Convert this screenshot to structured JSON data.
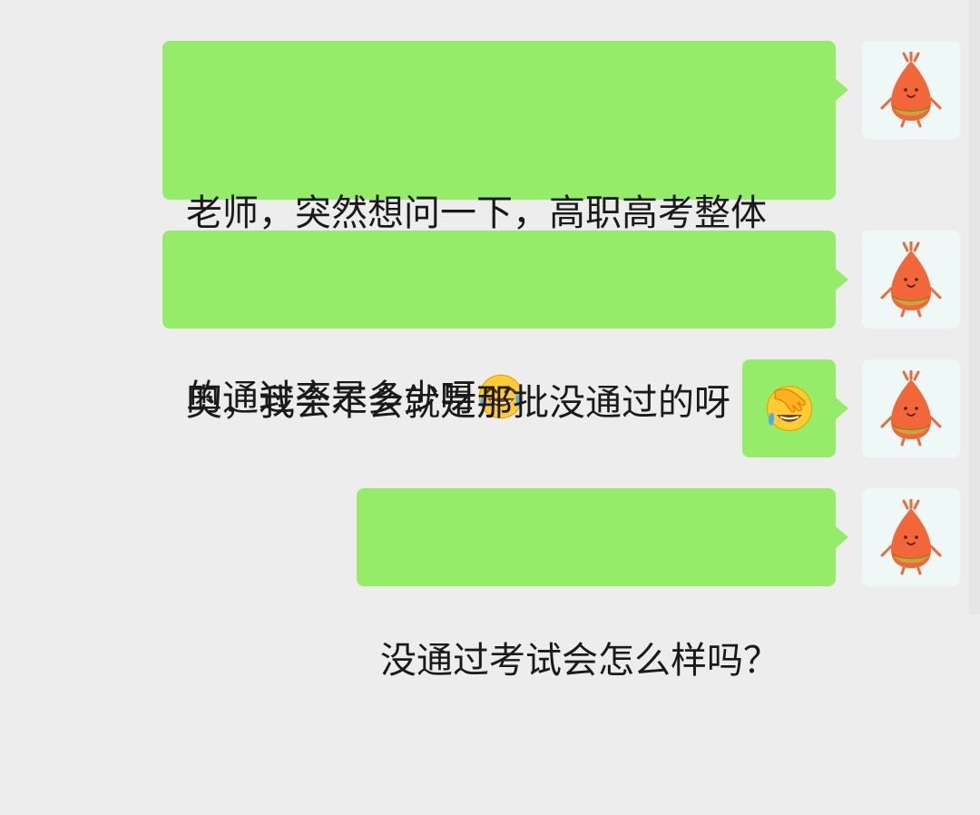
{
  "messages": [
    {
      "text_line1": "老师，突然想问一下，高职高考整体",
      "text_line2": "的通过率是多少呀",
      "emoji": "tears-of-joy-emoji"
    },
    {
      "text": "奥，我会不会就是那批没通过的呀"
    },
    {
      "emoji": "facepalm-emoji"
    },
    {
      "text": "没通过考试会怎么样吗？"
    }
  ],
  "avatar": {
    "icon": "orange-drop-creature-avatar-icon"
  },
  "colors": {
    "background": "#ededed",
    "bubble": "#95ec69",
    "avatar_bg": "#eef9f7",
    "avatar_body": "#f2673a"
  }
}
